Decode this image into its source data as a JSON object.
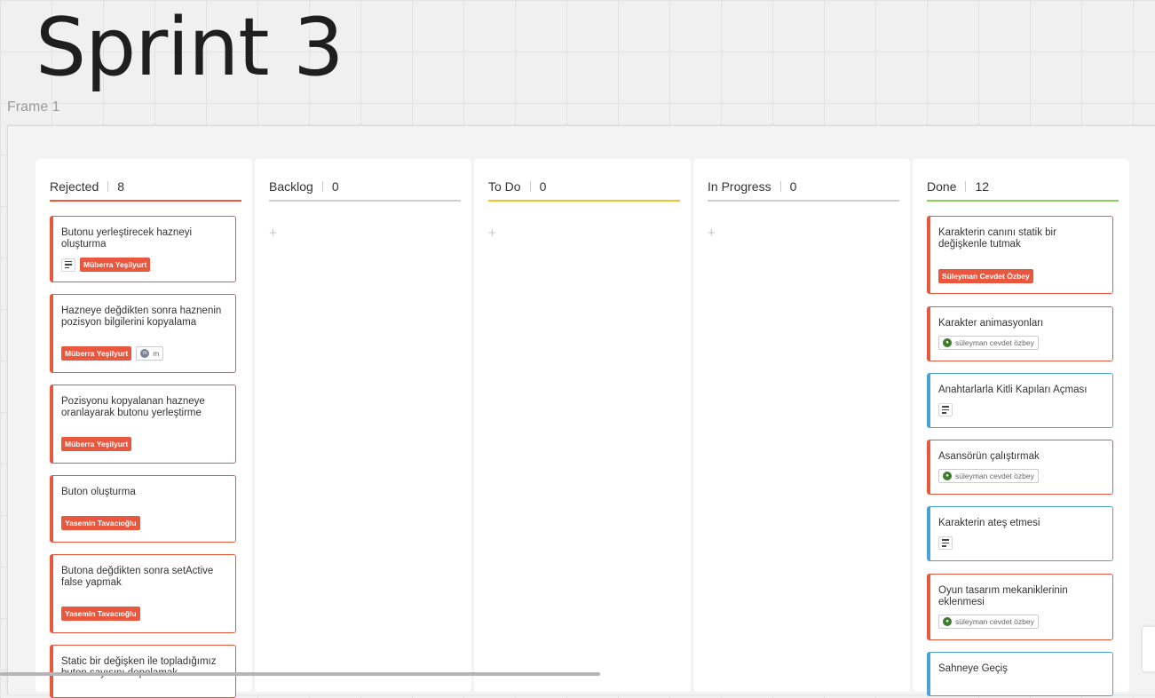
{
  "board": {
    "title": "Sprint 3",
    "frame_label": "Frame 1"
  },
  "colors": {
    "rejected": "#e9573f",
    "neutral": "#cfcfcf",
    "todo": "#f2c32b",
    "done": "#8fcf56",
    "blue_card": "#4aa3d6"
  },
  "columns": [
    {
      "name": "Rejected",
      "count": "8",
      "cards": [
        {
          "text": "Butonu yerleştirecek hazneyi oluşturma",
          "tag": "Müberra Yeşilyurt",
          "has_note": true
        },
        {
          "text": "Hazneye değdikten sonra haznenin pozisyon bilgilerini kopyalama",
          "tag": "Müberra Yeşilyurt",
          "extra_user": "m"
        },
        {
          "text": "Pozisyonu kopyalanan hazneye oranlayarak butonu yerleştirme",
          "tag": "Müberra Yeşilyurt"
        },
        {
          "text": "Buton oluşturma",
          "tag": "Yasemin Tavacıoğlu"
        },
        {
          "text": "Butona değdikten sonra setActive false yapmak",
          "tag": "Yasemin Tavacıoğlu"
        },
        {
          "text": "Static bir değişken ile topladığımız buton sayısını depolamak"
        }
      ]
    },
    {
      "name": "Backlog",
      "count": "0",
      "add_label": "+"
    },
    {
      "name": "To Do",
      "count": "0",
      "add_label": "+"
    },
    {
      "name": "In Progress",
      "count": "0",
      "add_label": "+"
    },
    {
      "name": "Done",
      "count": "12",
      "cards": [
        {
          "text": "Karakterin canını statik bir değişkenle tutmak",
          "tag": "Süleyman Cevdet Özbey"
        },
        {
          "text": "Karakter animasyonları",
          "user": "süleyman cevdet özbey"
        },
        {
          "text": "Anahtarlarla Kitli Kapıları  Açması",
          "has_note": true
        },
        {
          "text": "Asansörün çalıştırmak",
          "user": "süleyman cevdet özbey"
        },
        {
          "text": "Karakterin ateş etmesi",
          "has_note": true
        },
        {
          "text": "Oyun tasarım mekaniklerinin eklenmesi",
          "user": "süleyman cevdet özbey"
        },
        {
          "text": "Sahneye Geçiş"
        }
      ]
    }
  ]
}
